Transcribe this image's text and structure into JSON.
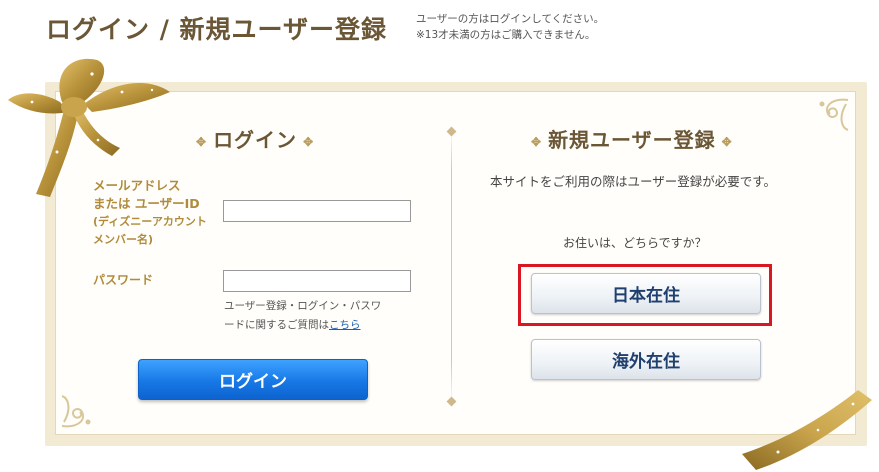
{
  "header": {
    "title": "ログイン / 新規ユーザー登録",
    "note_line1": "ユーザーの方はログインしてください。",
    "note_line2": "※13才未満の方はご購入できません。"
  },
  "login": {
    "heading": "ログイン",
    "email_label_1": "メールアドレス",
    "email_label_2": "または ユーザーID",
    "email_label_3": "(ディズニーアカウント",
    "email_label_4": "メンバー名)",
    "email_value": "",
    "password_label": "パスワード",
    "password_value": "",
    "help_text_1": "ユーザー登録・ログイン・パスワ",
    "help_text_2": "ードに関するご質問は",
    "help_link": "こちら",
    "button_label": "ログイン"
  },
  "register": {
    "heading": "新規ユーザー登録",
    "description": "本サイトをご利用の際はユーザー登録が必要です。",
    "question": "お住いは、どちらですか？",
    "japan_button": "日本在住",
    "overseas_button": "海外在住"
  },
  "colors": {
    "gold_text": "#6b5636",
    "label_gold": "#b08b3c",
    "frame": "#f3ead4",
    "login_blue": "#1778e6",
    "highlight_red": "#d91622"
  }
}
